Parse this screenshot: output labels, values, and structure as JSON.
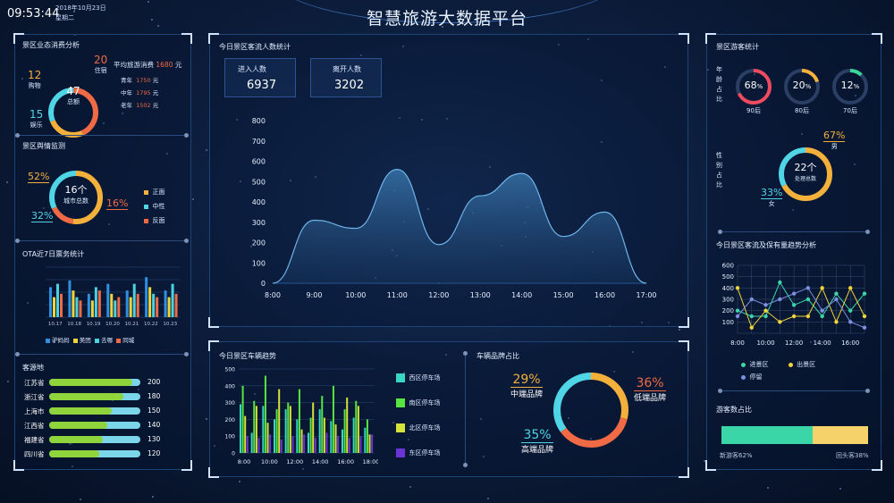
{
  "header": {
    "title": "智慧旅游大数据平台",
    "time": "09:53:44",
    "date": "2018年10月23日",
    "weekday": "星期二"
  },
  "consumption": {
    "title": "景区业态消费分析",
    "total": "47",
    "total_label": "总额",
    "items": [
      {
        "value": "20",
        "label": "住宿",
        "color": "#ef6a45"
      },
      {
        "value": "12",
        "label": "购物",
        "color": "#f3b13b"
      },
      {
        "value": "15",
        "label": "娱乐",
        "color": "#50d5e6"
      }
    ],
    "avg_label": "平均旅游消费",
    "avg_value": "1680",
    "avg_unit": "元",
    "groups": [
      {
        "label": "青年",
        "value": "1750",
        "unit": "元"
      },
      {
        "label": "中年",
        "value": "1795",
        "unit": "元"
      },
      {
        "label": "老年",
        "value": "1502",
        "unit": "元"
      }
    ]
  },
  "opinion": {
    "title": "景区舆情监测",
    "center_value": "16个",
    "center_label": "城市总数",
    "p_positive": "52%",
    "p_neutral": "32%",
    "p_negative": "16%",
    "legend": [
      {
        "label": "正面",
        "color": "#f3b13b"
      },
      {
        "label": "中性",
        "color": "#50d5e6"
      },
      {
        "label": "反面",
        "color": "#ef6a45"
      }
    ]
  },
  "ota": {
    "title": "OTA近7日票务统计",
    "legend": [
      {
        "label": "驴妈妈",
        "color": "#2f8fe0"
      },
      {
        "label": "美团",
        "color": "#f0d43a"
      },
      {
        "label": "去哪",
        "color": "#4ad2e0"
      },
      {
        "label": "同城",
        "color": "#ef6a45"
      }
    ]
  },
  "sources": {
    "title": "客源地",
    "items": [
      {
        "label": "江苏省",
        "value": 200
      },
      {
        "label": "浙江省",
        "value": 180
      },
      {
        "label": "上海市",
        "value": 150
      },
      {
        "label": "江西省",
        "value": 140
      },
      {
        "label": "福建省",
        "value": 130
      },
      {
        "label": "四川省",
        "value": 120
      }
    ]
  },
  "flow": {
    "title": "今日景区客流人数统计",
    "in_label": "进入人数",
    "in_value": "6937",
    "out_label": "离开人数",
    "out_value": "3202"
  },
  "vehicle": {
    "title": "今日景区车辆趋势",
    "legend": [
      {
        "label": "西区停车场",
        "color": "#3ad6c4"
      },
      {
        "label": "南区停车场",
        "color": "#57e640"
      },
      {
        "label": "北区停车场",
        "color": "#d6e23a"
      },
      {
        "label": "东区停车场",
        "color": "#6a34d6"
      }
    ]
  },
  "brand": {
    "title": "车辆品牌占比",
    "items": [
      {
        "value": "29%",
        "label": "中端品牌",
        "color": "#f3b13b"
      },
      {
        "value": "36%",
        "label": "低端品牌",
        "color": "#ef6a45"
      },
      {
        "value": "35%",
        "label": "高端品牌",
        "color": "#50d5e6"
      }
    ]
  },
  "visitor": {
    "title": "景区游客统计",
    "age_label": "年龄占比",
    "ages": [
      {
        "value": "68",
        "unit": "%",
        "label": "90后",
        "pct": 0.68,
        "color": "#ef4a5e"
      },
      {
        "value": "20",
        "unit": "%",
        "label": "80后",
        "pct": 0.2,
        "color": "#f3b13b"
      },
      {
        "value": "12",
        "unit": "%",
        "label": "70后",
        "pct": 0.12,
        "color": "#3ad69a"
      }
    ],
    "gender_label": "性别占比",
    "gender_total": "22个",
    "gender_total_label": "处理总数",
    "male_pct": "67%",
    "male_label": "男",
    "female_pct": "33%",
    "female_label": "女"
  },
  "trend": {
    "title": "今日景区客流及保有量趋势分析",
    "legend": [
      {
        "label": "进景区",
        "color": "#3ad6a8"
      },
      {
        "label": "出景区",
        "color": "#f0d43a"
      },
      {
        "label": "停留",
        "color": "#7c8fe0"
      }
    ]
  },
  "ratio": {
    "title": "游客数占比",
    "new_label": "新游客62%",
    "old_label": "回头客38%",
    "new_pct": 0.62,
    "new_color": "#3ad6a8",
    "old_color": "#f5d36a"
  },
  "chart_data": [
    {
      "type": "area",
      "x": [
        "8:00",
        "9:00",
        "10:00",
        "11:00",
        "12:00",
        "13:00",
        "14:00",
        "15:00",
        "16:00",
        "17:00"
      ],
      "values": [
        0,
        310,
        270,
        560,
        190,
        430,
        540,
        230,
        350,
        0
      ],
      "ylim": [
        0,
        800
      ],
      "yticks": [
        0,
        100,
        200,
        300,
        400,
        500,
        600,
        700,
        800
      ]
    },
    {
      "type": "bar",
      "categories": [
        "10.17",
        "10.18",
        "10.19",
        "10.20",
        "10.21",
        "10.22",
        "10.23"
      ],
      "series": [
        {
          "name": "驴妈妈",
          "values": [
            18,
            22,
            14,
            20,
            16,
            24,
            16
          ]
        },
        {
          "name": "美团",
          "values": [
            12,
            16,
            10,
            14,
            12,
            18,
            12
          ]
        },
        {
          "name": "去哪",
          "values": [
            20,
            12,
            18,
            10,
            20,
            14,
            20
          ]
        },
        {
          "name": "同城",
          "values": [
            14,
            10,
            16,
            12,
            14,
            12,
            14
          ]
        }
      ],
      "ylim": [
        0,
        30
      ]
    },
    {
      "type": "bar",
      "categories": [
        "8:00",
        "10:00",
        "12:00",
        "14:00",
        "16:00",
        "18:00"
      ],
      "series": [
        {
          "name": "西区停车场",
          "values": [
            290,
            120,
            280,
            200,
            260,
            200,
            120,
            260,
            190,
            140,
            210,
            150
          ]
        },
        {
          "name": "南区停车场",
          "values": [
            400,
            310,
            460,
            260,
            300,
            380,
            210,
            340,
            400,
            260,
            310,
            200
          ]
        },
        {
          "name": "北区停车场",
          "values": [
            220,
            280,
            180,
            380,
            280,
            140,
            300,
            210,
            170,
            330,
            280,
            110
          ]
        },
        {
          "name": "东区停车场",
          "values": [
            100,
            90,
            110,
            80,
            100,
            110,
            90,
            120,
            100,
            90,
            100,
            110
          ]
        }
      ],
      "ylim": [
        0,
        500
      ],
      "yticks": [
        0,
        100,
        200,
        300,
        400,
        500
      ]
    },
    {
      "type": "line",
      "x": [
        "8:00",
        "",
        "10:00",
        "",
        "12:00",
        "",
        "14:00",
        "",
        "16:00",
        ""
      ],
      "series": [
        {
          "name": "进景区",
          "values": [
            200,
            150,
            150,
            450,
            250,
            300,
            150,
            350,
            200,
            350
          ]
        },
        {
          "name": "出景区",
          "values": [
            400,
            50,
            200,
            100,
            150,
            150,
            400,
            100,
            400,
            150
          ]
        },
        {
          "name": "停留",
          "values": [
            150,
            300,
            250,
            300,
            350,
            400,
            200,
            300,
            100,
            50
          ]
        }
      ],
      "ylim": [
        0,
        600
      ],
      "yticks": [
        100,
        200,
        300,
        400,
        500,
        600
      ]
    }
  ]
}
